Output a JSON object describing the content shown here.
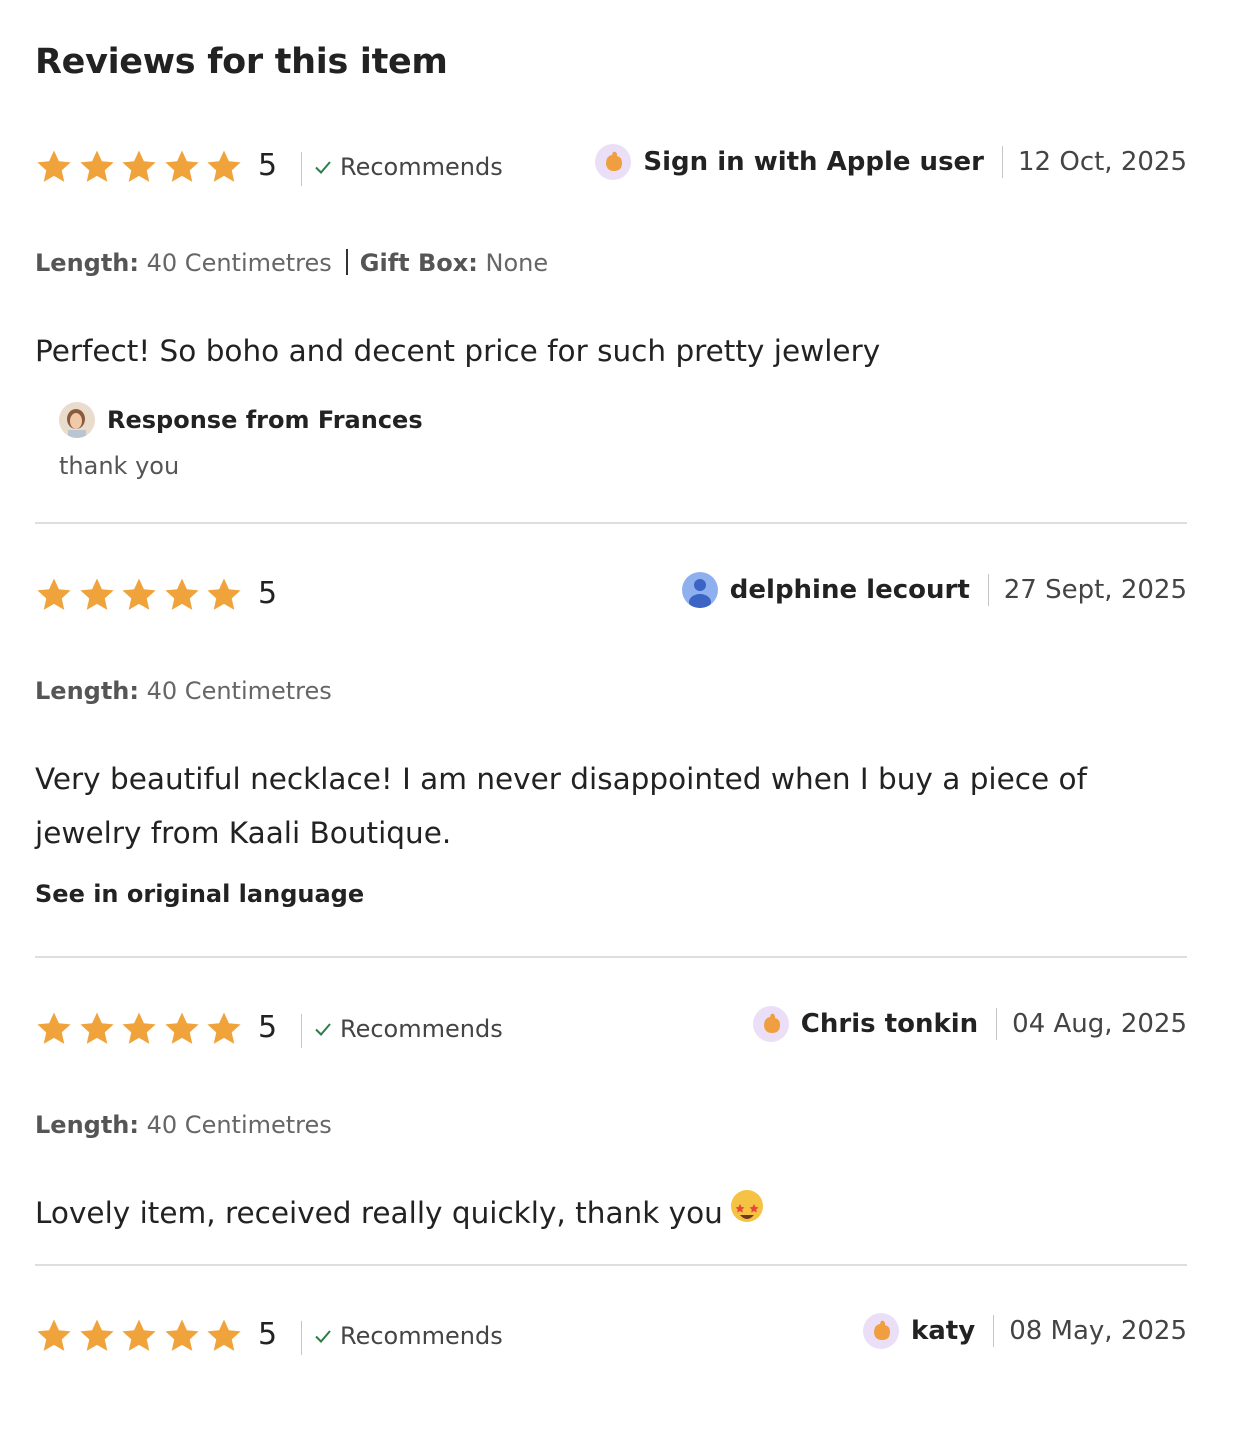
{
  "heading": "Reviews for this item",
  "colors": {
    "star": "#f1a33b",
    "check": "#2d7d47",
    "divider": "#dedede"
  },
  "reviews": [
    {
      "stars": 5,
      "rating_label": "5",
      "recommends": "Recommends",
      "user": "Sign in with Apple user",
      "date": "12 Oct, 2025",
      "avatar_icon": "guest-hand-icon",
      "variations": [
        {
          "label": "Length:",
          "value": "40 Centimetres"
        },
        {
          "label": "Gift Box:",
          "value": "None"
        }
      ],
      "text": "Perfect! So boho and decent price for such pretty jewlery",
      "response": {
        "from": "Response from Frances",
        "text": "thank you"
      }
    },
    {
      "stars": 5,
      "rating_label": "5",
      "recommends": "",
      "user": "delphine lecourt",
      "date": "27 Sept, 2025",
      "avatar_icon": "person-icon",
      "variations": [
        {
          "label": "Length:",
          "value": "40 Centimetres"
        }
      ],
      "text": "Very beautiful necklace! I am never disappointed when I buy a piece of jewelry from Kaali Boutique.",
      "link": "See in original language"
    },
    {
      "stars": 5,
      "rating_label": "5",
      "recommends": "Recommends",
      "user": "Chris tonkin",
      "date": "04 Aug, 2025",
      "avatar_icon": "guest-hand-icon",
      "variations": [
        {
          "label": "Length:",
          "value": "40 Centimetres"
        }
      ],
      "text": "Lovely item, received really quickly, thank you"
    },
    {
      "stars": 5,
      "rating_label": "5",
      "recommends": "Recommends",
      "user": "katy",
      "date": "08 May, 2025",
      "avatar_icon": "guest-hand-icon"
    }
  ]
}
